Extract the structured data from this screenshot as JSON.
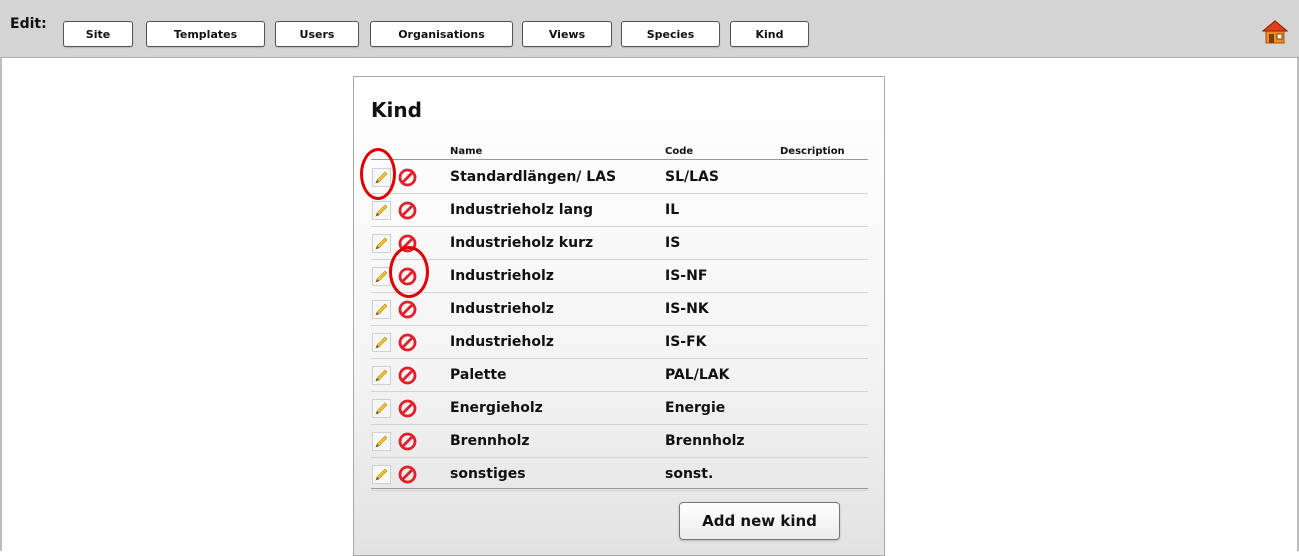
{
  "toolbar": {
    "edit_label": "Edit:",
    "buttons": [
      {
        "label": "Site"
      },
      {
        "label": "Templates"
      },
      {
        "label": "Users"
      },
      {
        "label": "Organisations"
      },
      {
        "label": "Views"
      },
      {
        "label": "Species"
      },
      {
        "label": "Kind"
      }
    ],
    "home_icon": "home-icon"
  },
  "panel": {
    "title": "Kind",
    "columns": {
      "name": "Name",
      "code": "Code",
      "description": "Description"
    },
    "rows": [
      {
        "name": "Standardlängen/ LAS",
        "code": "SL/LAS",
        "description": ""
      },
      {
        "name": "Industrieholz lang",
        "code": "IL",
        "description": ""
      },
      {
        "name": "Industrieholz kurz",
        "code": "IS",
        "description": ""
      },
      {
        "name": "Industrieholz",
        "code": "IS-NF",
        "description": ""
      },
      {
        "name": "Industrieholz",
        "code": "IS-NK",
        "description": ""
      },
      {
        "name": "Industrieholz",
        "code": "IS-FK",
        "description": ""
      },
      {
        "name": "Palette",
        "code": "PAL/LAK",
        "description": ""
      },
      {
        "name": "Energieholz",
        "code": "Energie",
        "description": ""
      },
      {
        "name": "Brennholz",
        "code": "Brennholz",
        "description": ""
      },
      {
        "name": "sonstiges",
        "code": "sonst.",
        "description": ""
      }
    ],
    "row_icons": {
      "edit": "pencil-icon",
      "delete": "delete-icon"
    },
    "add_button": "Add new kind"
  },
  "colors": {
    "toolbar_bg": "#d4d4d4",
    "annotation_ring": "#e00000",
    "delete_icon": "#e0202a",
    "pencil_icon": "#f2c12e"
  }
}
